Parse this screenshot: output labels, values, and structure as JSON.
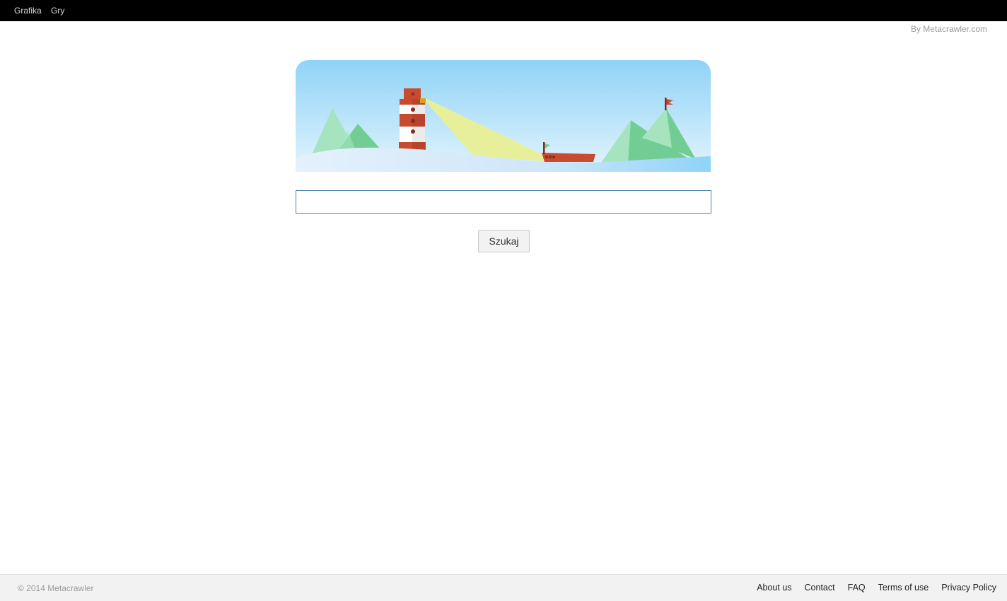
{
  "topnav": {
    "items": [
      {
        "label": "Grafika"
      },
      {
        "label": "Gry"
      }
    ]
  },
  "byline": "By Metacrawler.com",
  "banner": {
    "icon": "lighthouse-sea-illustration",
    "colors": {
      "sky_top": "#8fd3f7",
      "sky_bottom": "#dff3fd",
      "hill_light": "#a6e4bf",
      "hill_dark": "#72cd95",
      "lighthouse_red": "#c84b2f",
      "beam": "#e7ef9a",
      "water": "#cfe6f9"
    }
  },
  "search": {
    "value": "",
    "placeholder": "",
    "button_label": "Szukaj"
  },
  "footer": {
    "copyright": "© 2014 Metacrawler",
    "links": [
      {
        "label": "About us"
      },
      {
        "label": "Contact"
      },
      {
        "label": "FAQ"
      },
      {
        "label": "Terms of use"
      },
      {
        "label": "Privacy Policy"
      }
    ]
  },
  "colors": {
    "topbar_bg": "#000000",
    "input_border": "#4a7fa6",
    "footer_bg": "#f2f2f2"
  }
}
